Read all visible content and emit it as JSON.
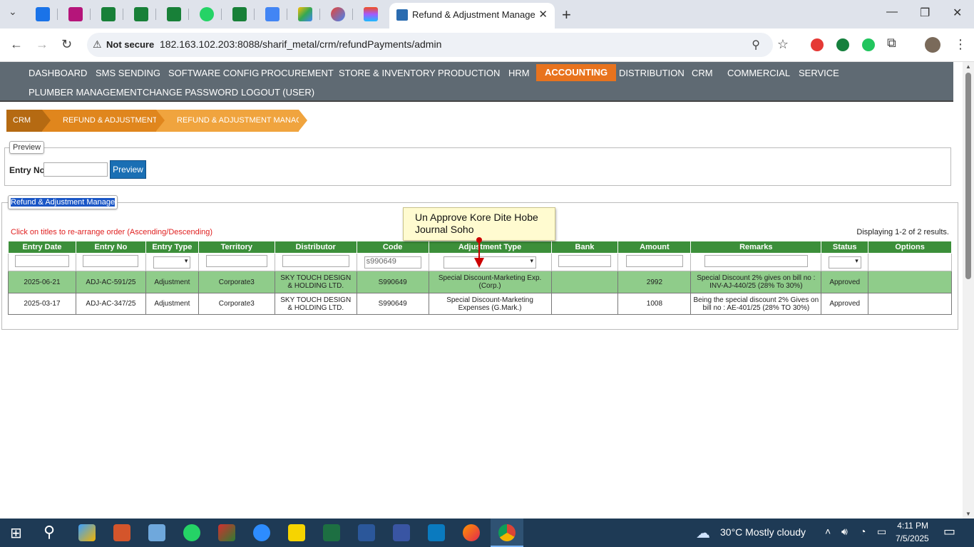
{
  "browser": {
    "tab_title": "Refund & Adjustment Manage",
    "not_secure": "Not secure",
    "url": "182.163.102.203:8088/sharif_metal/crm/refundPayments/admin"
  },
  "menu": {
    "row1": [
      "DASHBOARD",
      "SMS SENDING",
      "SOFTWARE CONFIG",
      "PROCUREMENT",
      "STORE & INVENTORY",
      "PRODUCTION",
      "HRM",
      "ACCOUNTING",
      "DISTRIBUTION",
      "CRM",
      "COMMERCIAL",
      "SERVICE"
    ],
    "row2": [
      "PLUMBER MANAGEMENT",
      "CHANGE PASSWORD",
      "LOGOUT (USER)"
    ],
    "active": "ACCOUNTING",
    "active_color": "#e8731e"
  },
  "breadcrumb": [
    "CRM",
    "REFUND & ADJUSTMENT",
    "REFUND & ADJUSTMENT MANAGE"
  ],
  "preview": {
    "legend": "Preview",
    "entry_label": "Entry No",
    "entry_value": "",
    "button": "Preview"
  },
  "grid": {
    "legend": "Refund & Adjustment Manage",
    "hint": "Click on titles to re-arrange order (Ascending/Descending)",
    "summary": "Displaying 1-2 of 2 results.",
    "columns": [
      "Entry Date",
      "Entry No",
      "Entry Type",
      "Territory",
      "Distributor",
      "Code",
      "Adjustment Type",
      "Bank",
      "Amount",
      "Remarks",
      "Status",
      "Options"
    ],
    "code_filter": "s990649",
    "rows": [
      {
        "date": "2025-06-21",
        "entry_no": "ADJ-AC-591/25",
        "type": "Adjustment",
        "territory": "Corporate3",
        "distributor": "SKY TOUCH DESIGN & HOLDING LTD.",
        "code": "S990649",
        "adj_type": "Special Discount-Marketing Exp. (Corp.)",
        "bank": "",
        "amount": "2992",
        "remarks": "Special Discount 2% gives on bill no : INV-AJ-440/25 (28% To 30%)",
        "status": "Approved",
        "options": ""
      },
      {
        "date": "2025-03-17",
        "entry_no": "ADJ-AC-347/25",
        "type": "Adjustment",
        "territory": "Corporate3",
        "distributor": "SKY TOUCH DESIGN & HOLDING LTD.",
        "code": "S990649",
        "adj_type": "Special Discount-Marketing Expenses (G.Mark.)",
        "bank": "",
        "amount": "1008",
        "remarks": "Being the special discount 2% Gives on bill no : AE-401/25 (28% TO 30%)",
        "status": "Approved",
        "options": ""
      }
    ]
  },
  "tooltip": "Un Approve Kore Dite Hobe Journal Soho",
  "taskbar": {
    "weather": "30°C  Mostly cloudy",
    "time": "4:11 PM",
    "date": "7/5/2025"
  }
}
